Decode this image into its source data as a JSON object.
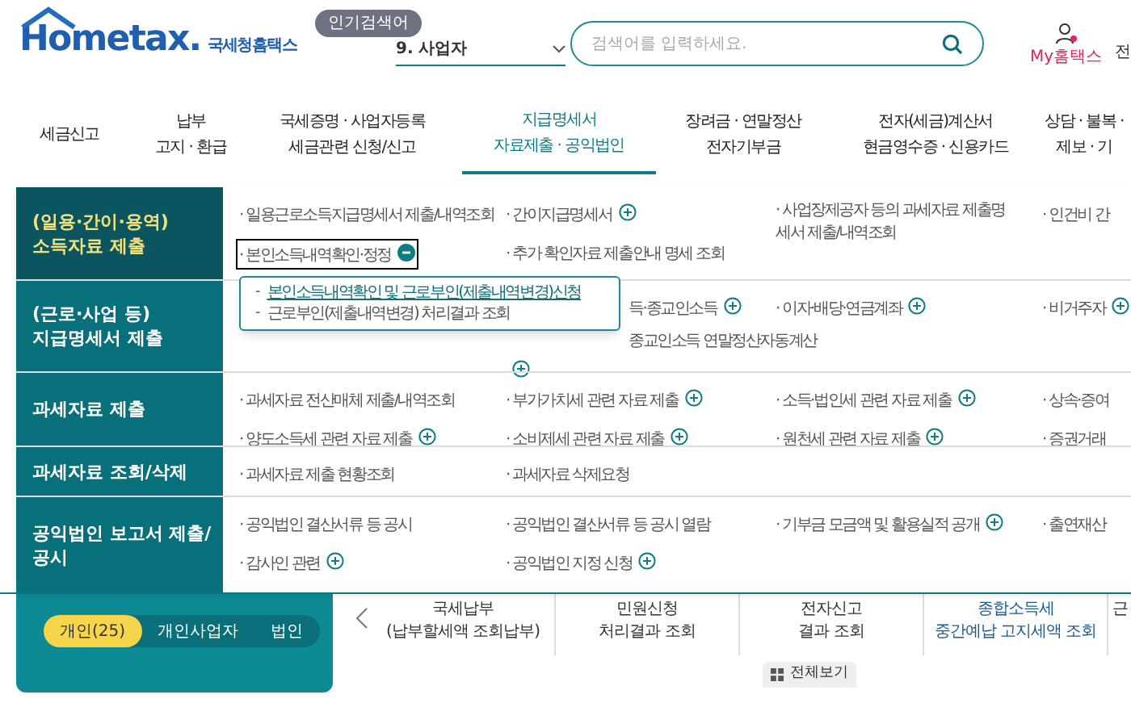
{
  "header": {
    "logo_text": "Hometax.",
    "brand": "국세청홈택스",
    "popular_badge": "인기검색어",
    "popular_term": "9.  사업자",
    "search": {
      "placeholder": "검색어를 입력하세요."
    },
    "my_link": "My홈택스",
    "cut_link": "전"
  },
  "nav": [
    {
      "lines": [
        "세금신고"
      ],
      "selected": false
    },
    {
      "lines": [
        "납부",
        "고지 · 환급"
      ],
      "selected": false
    },
    {
      "lines": [
        "국세증명 · 사업자등록",
        "세금관련 신청/신고"
      ],
      "selected": false
    },
    {
      "lines": [
        "지급명세서",
        "자료제출 · 공익법인"
      ],
      "selected": true
    },
    {
      "lines": [
        "장려금 · 연말정산",
        "전자기부금"
      ],
      "selected": false
    },
    {
      "lines": [
        "전자(세금)계산서",
        "현금영수증 · 신용카드"
      ],
      "selected": false
    },
    {
      "lines": [
        "상담 · 불복 ·",
        "제보 · 기"
      ],
      "selected": false
    }
  ],
  "menu": [
    {
      "title_lines": [
        "(일용·간이·용역)",
        "소득자료 제출"
      ],
      "selected": true,
      "columns": [
        [
          {
            "text": "· 일용근로소득지급명세서 제출/내역조회",
            "kind": "plain"
          },
          {
            "text": "· 본인소득내역확인·정정",
            "kind": "expanded"
          }
        ],
        [
          {
            "text": "· 간이지급명세서",
            "kind": "collapsed"
          },
          {
            "text": "· 추가 확인자료 제출안내 명세 조회",
            "kind": "plain"
          }
        ],
        [
          {
            "text": "· 사업장제공자 등의 과세자료 제출명세서 제출/내역조회",
            "kind": "plain"
          }
        ],
        [
          {
            "text": "· 인건비 간",
            "kind": "plain"
          }
        ]
      ]
    },
    {
      "title_lines": [
        "(근로·사업 등)",
        "지급명세서 제출"
      ],
      "selected": false,
      "columns": [
        [],
        [
          {
            "text": "득·종교인소득",
            "kind": "collapsed"
          },
          {
            "text": "종교인소득 연말정산자동계산",
            "kind": "plain"
          }
        ],
        [
          {
            "text": "· 이자·배당·연금계좌",
            "kind": "collapsed"
          }
        ],
        [
          {
            "text": "· 비거주자",
            "kind": "collapsed"
          }
        ]
      ]
    },
    {
      "title_lines": [
        "과세자료 제출"
      ],
      "selected": false,
      "columns": [
        [
          {
            "text": "· 과세자료 전산매체 제출/내역조회",
            "kind": "plain"
          },
          {
            "text": "· 양도소득세 관련 자료 제출",
            "kind": "collapsed"
          }
        ],
        [
          {
            "text": "· 부가가치세 관련 자료 제출",
            "kind": "collapsed"
          },
          {
            "text": "· 소비제세 관련 자료 제출",
            "kind": "collapsed"
          }
        ],
        [
          {
            "text": "· 소득·법인세 관련 자료 제출",
            "kind": "collapsed"
          },
          {
            "text": "· 원천세 관련 자료 제출",
            "kind": "collapsed"
          }
        ],
        [
          {
            "text": "· 상속·증여",
            "kind": "plain"
          },
          {
            "text": "· 증권거래",
            "kind": "plain"
          }
        ]
      ]
    },
    {
      "title_lines": [
        "과세자료 조회/삭제"
      ],
      "selected": false,
      "columns": [
        [
          {
            "text": "· 과세자료 제출 현황조회",
            "kind": "plain"
          }
        ],
        [
          {
            "text": "· 과세자료 삭제요청",
            "kind": "plain"
          }
        ],
        [],
        []
      ]
    },
    {
      "title_lines": [
        "공익법인 보고서 제출/공시"
      ],
      "selected": false,
      "columns": [
        [
          {
            "text": "· 공익법인 결산서류 등 공시",
            "kind": "plain"
          },
          {
            "text": "· 감사인 관련",
            "kind": "collapsed"
          }
        ],
        [
          {
            "text": "· 공익법인 결산서류 등 공시 열람",
            "kind": "plain"
          },
          {
            "text": "· 공익법인 지정 신청",
            "kind": "collapsed"
          }
        ],
        [
          {
            "text": "· 기부금 모금액 및 활용실적 공개",
            "kind": "collapsed"
          }
        ],
        [
          {
            "text": "· 출연재산",
            "kind": "plain"
          }
        ]
      ]
    }
  ],
  "popover": [
    {
      "text": "본인소득내역확인 및 근로부인(제출내역변경)신청",
      "kind": "link"
    },
    {
      "text": "근로부인(제출내역변경) 처리결과 조회",
      "kind": "plain"
    }
  ],
  "popover_dash": "-",
  "user_tabs": [
    {
      "label": "개인(25)",
      "selected": true
    },
    {
      "label": "개인사업자",
      "selected": false
    },
    {
      "label": "법인",
      "selected": false
    }
  ],
  "quick_links": [
    {
      "lines": [
        "국세납부",
        "(납부할세액 조회납부)"
      ],
      "highlight": false
    },
    {
      "lines": [
        "민원신청",
        "처리결과 조회"
      ],
      "highlight": false
    },
    {
      "lines": [
        "전자신고",
        "결과 조회"
      ],
      "highlight": false
    },
    {
      "lines": [
        "종합소득세",
        "중간예납 고지세액 조회"
      ],
      "highlight": true
    },
    {
      "lines": [
        "근"
      ],
      "highlight": false
    }
  ],
  "view_all": "전체보기"
}
